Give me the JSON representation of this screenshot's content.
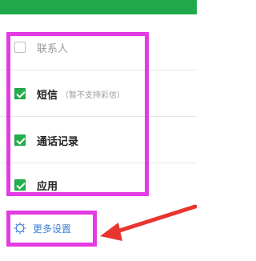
{
  "header": {
    "bar_color": "#20a84a"
  },
  "sync_options": {
    "items": [
      {
        "label": "联系人",
        "checked": false
      },
      {
        "label": "短信",
        "checked": true,
        "note": "（暂不支持彩信）"
      },
      {
        "label": "通话记录",
        "checked": true
      },
      {
        "label": "应用",
        "checked": true
      }
    ]
  },
  "more_settings": {
    "label": "更多设置",
    "icon": "gear-icon"
  },
  "annotations": {
    "highlight_color": "#e33be3",
    "arrow_color": "#e8352f"
  }
}
